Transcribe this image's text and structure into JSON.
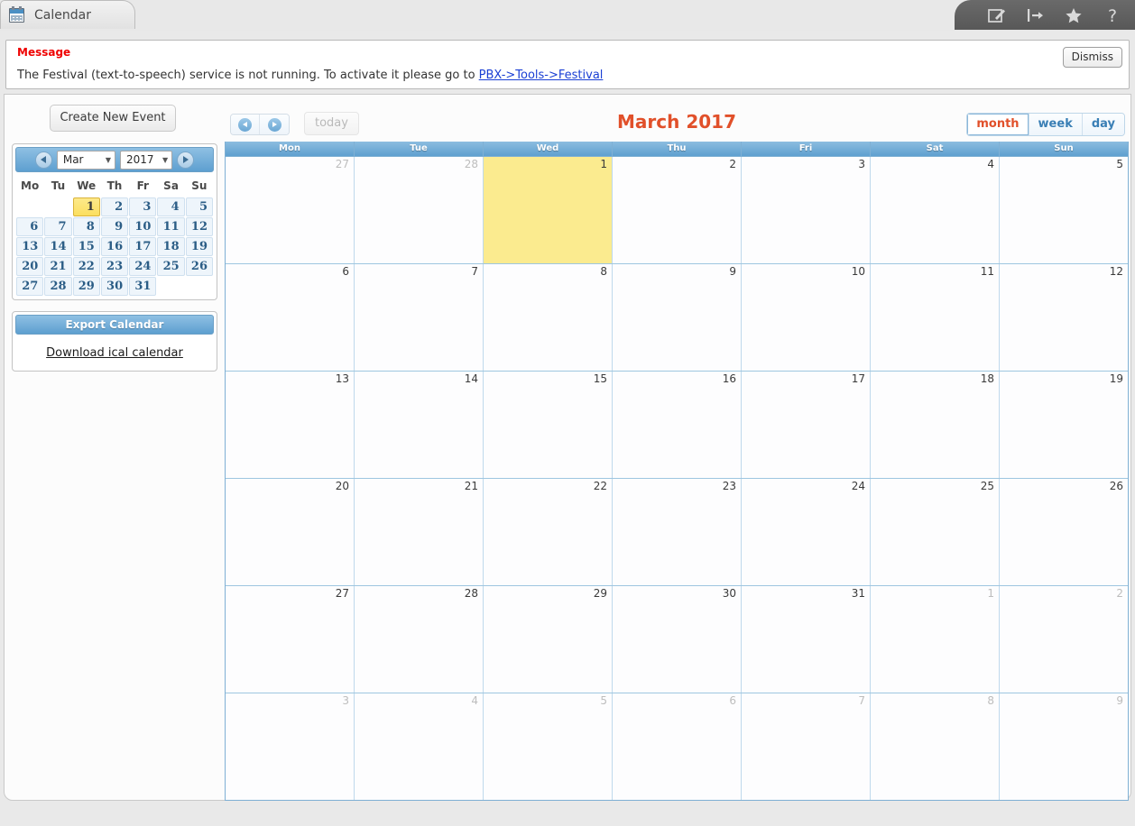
{
  "window": {
    "tab_label": "Calendar",
    "tab_icon": "calendar-icon",
    "tools": [
      {
        "name": "compose-icon",
        "label": "Compose"
      },
      {
        "name": "logout-icon",
        "label": "Logout"
      },
      {
        "name": "favorite-star-icon",
        "label": "Favorite"
      },
      {
        "name": "help-icon",
        "label": "?"
      }
    ]
  },
  "message": {
    "title": "Message",
    "body_prefix": "The Festival (text-to-speech) service is not running. To activate it please go to ",
    "link_text": "PBX->Tools->Festival",
    "dismiss_label": "Dismiss"
  },
  "sidebar": {
    "create_event_label": "Create New Event",
    "minical": {
      "prev_label": "◀",
      "next_label": "▶",
      "month_value": "Mar",
      "year_value": "2017",
      "weekday_headers": [
        "Mo",
        "Tu",
        "We",
        "Th",
        "Fr",
        "Sa",
        "Su"
      ],
      "weeks": [
        [
          "",
          "",
          "1",
          "2",
          "3",
          "4",
          "5"
        ],
        [
          "6",
          "7",
          "8",
          "9",
          "10",
          "11",
          "12"
        ],
        [
          "13",
          "14",
          "15",
          "16",
          "17",
          "18",
          "19"
        ],
        [
          "20",
          "21",
          "22",
          "23",
          "24",
          "25",
          "26"
        ],
        [
          "27",
          "28",
          "29",
          "30",
          "31",
          "",
          ""
        ]
      ],
      "today": "1"
    },
    "export": {
      "header_label": "Export Calendar",
      "download_link_label": "Download ical calendar"
    }
  },
  "calendar": {
    "title": "March 2017",
    "today_button_label": "today",
    "prev_button_label": "prev",
    "next_button_label": "next",
    "views": [
      {
        "id": "month",
        "label": "month",
        "active": true
      },
      {
        "id": "week",
        "label": "week",
        "active": false
      },
      {
        "id": "day",
        "label": "day",
        "active": false
      }
    ],
    "day_headers": [
      "Mon",
      "Tue",
      "Wed",
      "Thu",
      "Fri",
      "Sat",
      "Sun"
    ],
    "highlight_column_index": 2,
    "weeks": [
      [
        {
          "num": "27",
          "other": true
        },
        {
          "num": "28",
          "other": true
        },
        {
          "num": "1",
          "other": false,
          "today": true
        },
        {
          "num": "2",
          "other": false
        },
        {
          "num": "3",
          "other": false
        },
        {
          "num": "4",
          "other": false
        },
        {
          "num": "5",
          "other": false
        }
      ],
      [
        {
          "num": "6",
          "other": false
        },
        {
          "num": "7",
          "other": false
        },
        {
          "num": "8",
          "other": false
        },
        {
          "num": "9",
          "other": false
        },
        {
          "num": "10",
          "other": false
        },
        {
          "num": "11",
          "other": false
        },
        {
          "num": "12",
          "other": false
        }
      ],
      [
        {
          "num": "13",
          "other": false
        },
        {
          "num": "14",
          "other": false
        },
        {
          "num": "15",
          "other": false
        },
        {
          "num": "16",
          "other": false
        },
        {
          "num": "17",
          "other": false
        },
        {
          "num": "18",
          "other": false
        },
        {
          "num": "19",
          "other": false
        }
      ],
      [
        {
          "num": "20",
          "other": false
        },
        {
          "num": "21",
          "other": false
        },
        {
          "num": "22",
          "other": false
        },
        {
          "num": "23",
          "other": false
        },
        {
          "num": "24",
          "other": false
        },
        {
          "num": "25",
          "other": false
        },
        {
          "num": "26",
          "other": false
        }
      ],
      [
        {
          "num": "27",
          "other": false
        },
        {
          "num": "28",
          "other": false
        },
        {
          "num": "29",
          "other": false
        },
        {
          "num": "30",
          "other": false
        },
        {
          "num": "31",
          "other": false
        },
        {
          "num": "1",
          "other": true
        },
        {
          "num": "2",
          "other": true
        }
      ],
      [
        {
          "num": "3",
          "other": true
        },
        {
          "num": "4",
          "other": true
        },
        {
          "num": "5",
          "other": true
        },
        {
          "num": "6",
          "other": true
        },
        {
          "num": "7",
          "other": true
        },
        {
          "num": "8",
          "other": true
        },
        {
          "num": "9",
          "other": true
        }
      ]
    ]
  },
  "colors": {
    "accent_orange": "#e1502a",
    "header_blue": "#5fa0d0",
    "today_yellow": "#fbeb8f",
    "link_blue": "#1a3fd4",
    "error_red": "#ef0000"
  }
}
